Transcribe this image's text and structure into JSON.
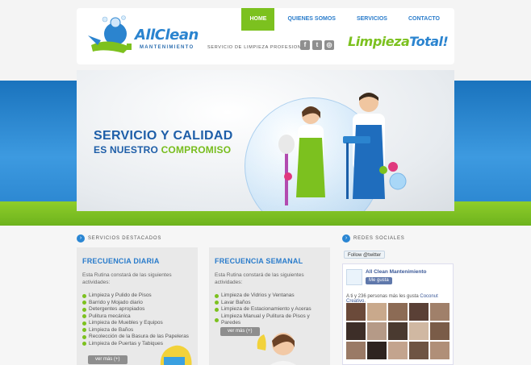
{
  "header": {
    "logo_main": "AllClean",
    "logo_sub": "MANTENIMIENTO",
    "tagline": "SERVICIO DE LIMPIEZA PROFESIONAL",
    "brand_left": "Limpieza",
    "brand_right": "Total!",
    "social_icons": [
      "facebook-icon",
      "twitter-icon",
      "camera-icon"
    ]
  },
  "nav": {
    "items": [
      {
        "label": "HOME",
        "active": true
      },
      {
        "label": "QUIENES SOMOS",
        "active": false
      },
      {
        "label": "SERVICIOS",
        "active": false
      },
      {
        "label": "CONTACTO",
        "active": false
      }
    ]
  },
  "slider": {
    "title": "SERVICIO Y CALIDAD",
    "subtitle_blue": "ES NUESTRO",
    "subtitle_green": "COMPROMISO",
    "dots": 5,
    "active_dot": 1
  },
  "sections": {
    "services": "SERVICIOS DESTACADOS",
    "social": "REDES SOCIALES"
  },
  "cards": [
    {
      "title": "FRECUENCIA DIARIA",
      "intro": "Esta Rutina constará de las siguientes actividades:",
      "items": [
        "Limpieza y Pulido de Pisos",
        "Barrido y Mojado diario",
        "Detergentes apropiados",
        "Pulitura mecánica",
        "Limpieza de Muebles y Equipos",
        "Limpieza de Baños",
        "Recolección de la Basura de las Papeleras",
        "Limpieza de Puertas y Tabiques"
      ],
      "button": "ver más (+)"
    },
    {
      "title": "FRECUENCIA SEMANAL",
      "intro": "Esta Rutina constará de las siguientes actividades:",
      "items": [
        "Limpieza de Vidrios y Ventanas",
        "Lavar Baños",
        "Limpieza de Estacionamiento y Aceras",
        "Limpieza Manual  y Pulitura de Pisos y Paredes"
      ],
      "button": "ver más (+)"
    }
  ],
  "social": {
    "twitter_button": "Follow @twitter",
    "fb_page": "All Clean Mantenimiento",
    "fb_like": "Me gusta",
    "fb_count_text": "A ti y 236 personas más les gusta",
    "fb_count_link": "Coconut Creativo."
  },
  "colors": {
    "brand_blue": "#2a7ccb",
    "brand_green": "#7cc11f"
  }
}
